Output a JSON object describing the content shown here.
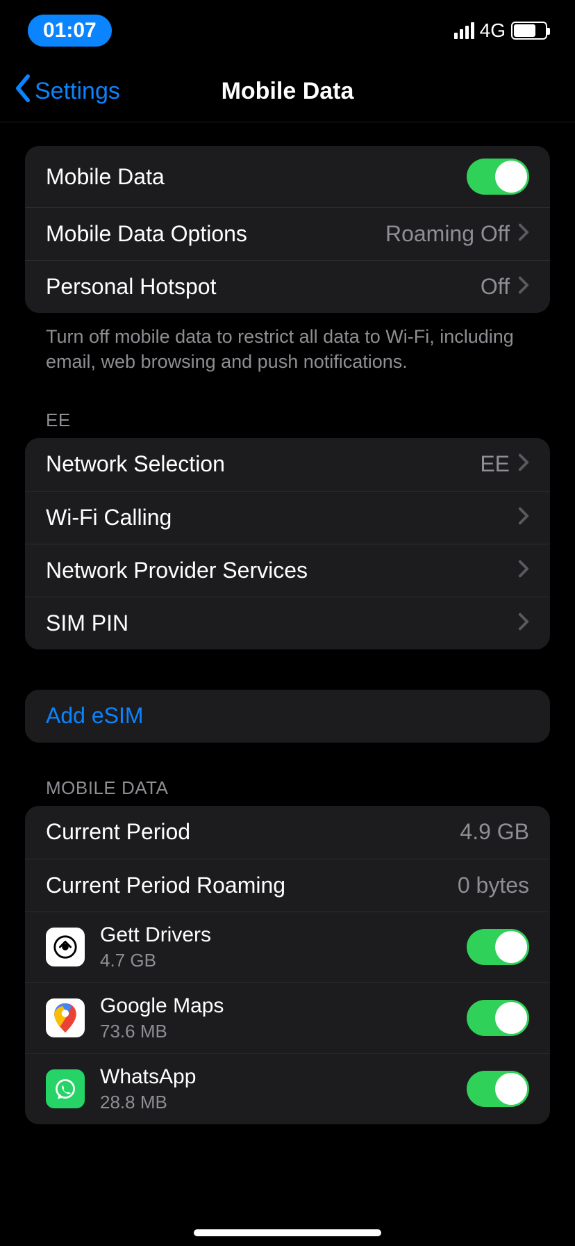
{
  "status": {
    "time": "01:07",
    "network": "4G"
  },
  "nav": {
    "back": "Settings",
    "title": "Mobile Data"
  },
  "group1": {
    "mobile_data": "Mobile Data",
    "options_label": "Mobile Data Options",
    "options_value": "Roaming Off",
    "hotspot_label": "Personal Hotspot",
    "hotspot_value": "Off",
    "footer": "Turn off mobile data to restrict all data to Wi-Fi, including email, web browsing and push notifications."
  },
  "carrier": {
    "header": "EE",
    "network_sel_label": "Network Selection",
    "network_sel_value": "EE",
    "wifi_calling": "Wi-Fi Calling",
    "provider_services": "Network Provider Services",
    "sim_pin": "SIM PIN"
  },
  "esim": {
    "add": "Add eSIM"
  },
  "usage": {
    "header": "MOBILE DATA",
    "current_label": "Current Period",
    "current_value": "4.9 GB",
    "roaming_label": "Current Period Roaming",
    "roaming_value": "0 bytes",
    "apps": [
      {
        "name": "Gett Drivers",
        "usage": "4.7 GB"
      },
      {
        "name": "Google Maps",
        "usage": "73.6 MB"
      },
      {
        "name": "WhatsApp",
        "usage": "28.8 MB"
      }
    ]
  }
}
